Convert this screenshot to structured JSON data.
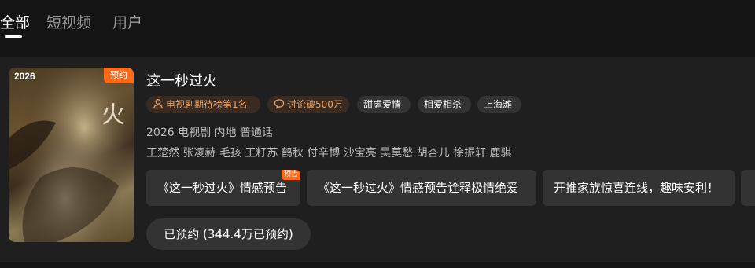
{
  "tabs": [
    {
      "label": "全部",
      "active": true
    },
    {
      "label": "短视频",
      "active": false
    },
    {
      "label": "用户",
      "active": false
    }
  ],
  "result": {
    "poster": {
      "year": "2026",
      "badge": "预约",
      "art_text": "火"
    },
    "title": "这一秒过火",
    "tags": {
      "rank": "电视剧期待榜第1名",
      "discuss": "讨论破500万",
      "genres": [
        "甜虐爱情",
        "相爱相杀",
        "上海滩"
      ]
    },
    "meta": "2026 电视剧 内地 普通话",
    "cast": "王楚然 张凌赫 毛孩 王籽苏 鹤秋 付辛博 沙宝亮 吴莫愁 胡杏儿 徐振轩 鹿骐",
    "clips": [
      {
        "label": "《这一秒过火》情感预告",
        "badge": "预告"
      },
      {
        "label": "《这一秒过火》情感预告诠释极情绝爱",
        "badge": ""
      },
      {
        "label": "开推家族惊喜连线，趣味安利！",
        "badge": ""
      },
      {
        "label": "",
        "badge": ""
      }
    ],
    "reserve_button": "已预约 (344.4万已预约)"
  },
  "colors": {
    "accent": "#ff6a1a",
    "tag_text": "#e7a36a",
    "background": "#141414",
    "card": "#1f1f1f"
  }
}
